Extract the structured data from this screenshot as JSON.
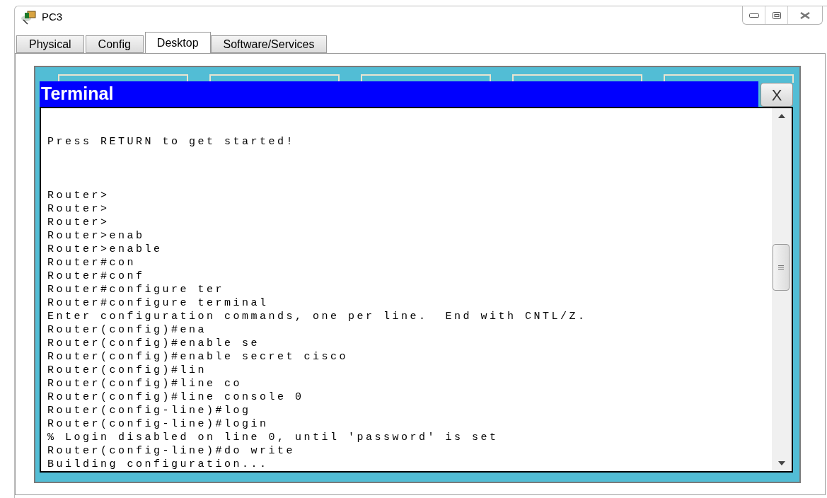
{
  "window": {
    "title": "PC3"
  },
  "tabs": [
    {
      "label": "Physical",
      "selected": false
    },
    {
      "label": "Config",
      "selected": false
    },
    {
      "label": "Desktop",
      "selected": true
    },
    {
      "label": "Software/Services",
      "selected": false
    }
  ],
  "terminal": {
    "title": "Terminal",
    "close_label": "X",
    "lines": [
      "Press RETURN to get started!",
      "Router>",
      "Router>",
      "Router>",
      "Router>enab",
      "Router>enable",
      "Router#con",
      "Router#conf",
      "Router#configure ter",
      "Router#configure terminal",
      "Enter configuration commands, one per line.  End with CNTL/Z.",
      "Router(config)#ena",
      "Router(config)#enable se",
      "Router(config)#enable secret cisco",
      "Router(config)#lin",
      "Router(config)#line co",
      "Router(config)#line console 0",
      "Router(config-line)#log",
      "Router(config-line)#login",
      "% Login disabled on line 0, until 'password' is set",
      "Router(config-line)#do write",
      "Building configuration..."
    ]
  }
}
